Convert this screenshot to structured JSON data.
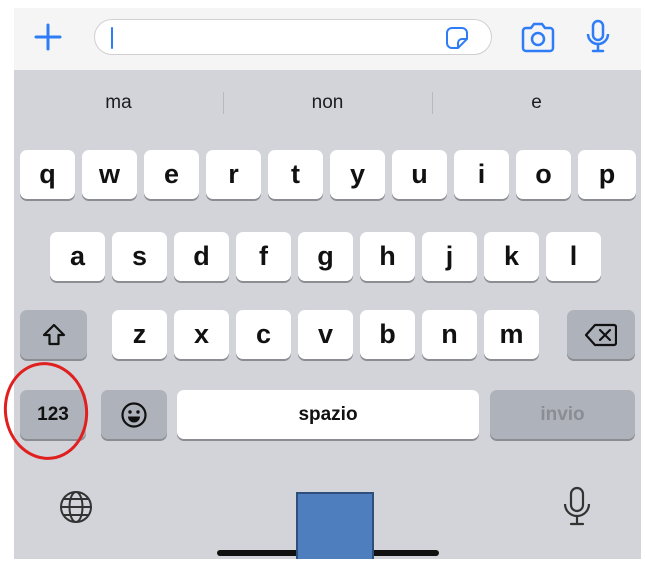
{
  "input_bar": {
    "plus_icon": "plus-icon",
    "field_value": "",
    "sticker_icon": "sticker-icon",
    "camera_icon": "camera-icon",
    "mic_icon": "microphone-icon"
  },
  "suggestions": [
    "ma",
    "non",
    "e"
  ],
  "keyboard": {
    "row1": [
      "q",
      "w",
      "e",
      "r",
      "t",
      "y",
      "u",
      "i",
      "o",
      "p"
    ],
    "row2": [
      "a",
      "s",
      "d",
      "f",
      "g",
      "h",
      "j",
      "k",
      "l"
    ],
    "row3": [
      "z",
      "x",
      "c",
      "v",
      "b",
      "n",
      "m"
    ],
    "shift_icon": "shift-icon",
    "backspace_icon": "backspace-icon",
    "numbers_label": "123",
    "emoji_icon": "emoji-icon",
    "space_label": "spazio",
    "return_label": "invio",
    "globe_icon": "globe-icon",
    "dictation_icon": "dictation-icon"
  },
  "colors": {
    "accent": "#2f7df6",
    "keyboard_bg": "#d2d4d9",
    "key": "#ffffff",
    "dark_key": "#aeb2ba",
    "annotation": "#e0201f",
    "overlay_square": "#4f7ebf"
  }
}
